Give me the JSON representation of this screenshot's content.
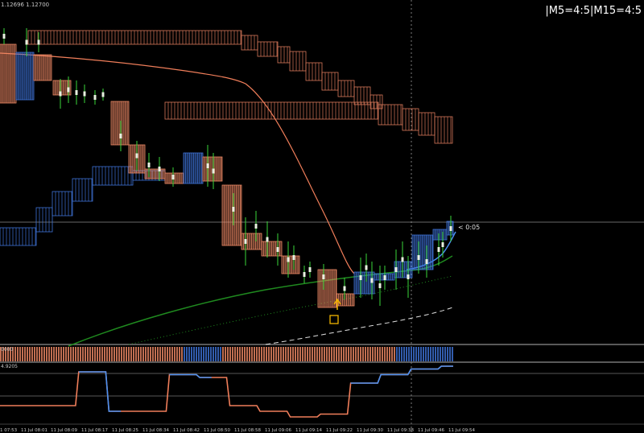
{
  "header": {
    "price_label": "1.12696 1.12700",
    "timeframe_strength": "|M5=4:5|M15=4:5"
  },
  "countdown_label": "< 0:05",
  "subwindow1": {
    "label": "0000"
  },
  "subwindow2": {
    "label": "4.9205"
  },
  "time_axis": {
    "labels": [
      "1 07:53",
      "11 Jul 08:01",
      "11 Jul 08:09",
      "11 Jul 08:17",
      "11 Jul 08:25",
      "11 Jul 08:34",
      "11 Jul 08:42",
      "11 Jul 08:50",
      "11 Jul 08:58",
      "11 Jul 09:06",
      "11 Jul 09:14",
      "11 Jul 09:22",
      "11 Jul 09:30",
      "11 Jul 09:38",
      "11 Jul 09:46",
      "11 Jul 09:54"
    ]
  },
  "colors": {
    "background": "#000000",
    "bear_bar": "#f08a66",
    "bull_bar": "#3f74d9",
    "cloud_bear": "#d9785a",
    "cloud_bull": "#3f74d9",
    "slow_ma": "#f07e5a",
    "green_ma": "#1f8a1f",
    "fast_ma": "#4a8ff0",
    "white_dashed": "#e0e0e0",
    "price_line": "#8a8a8a",
    "signal": "#f0b400"
  },
  "chart_data": {
    "type": "candlestick",
    "symbol": "",
    "timeframe": "M1",
    "y_range": [
      1.124,
      1.129
    ],
    "candles": [
      {
        "t": "07:53",
        "o": 1.1285,
        "h": 1.1287,
        "l": 1.1281,
        "c": 1.12825,
        "color": "bear"
      },
      {
        "t": "07:55",
        "o": 1.12825,
        "h": 1.12845,
        "l": 1.128,
        "c": 1.1284,
        "color": "bull"
      },
      {
        "t": "07:57",
        "o": 1.1284,
        "h": 1.1286,
        "l": 1.1279,
        "c": 1.128,
        "color": "bear"
      },
      {
        "t": "07:59",
        "o": 1.128,
        "h": 1.1283,
        "l": 1.1278,
        "c": 1.1281,
        "color": "bull"
      },
      {
        "t": "08:01",
        "o": 1.1281,
        "h": 1.1284,
        "l": 1.1279,
        "c": 1.128,
        "color": "bear"
      },
      {
        "t": "08:03",
        "o": 1.128,
        "h": 1.1286,
        "l": 1.1279,
        "c": 1.1284,
        "color": "bull"
      },
      {
        "t": "08:05",
        "o": 1.1284,
        "h": 1.1285,
        "l": 1.1278,
        "c": 1.1279,
        "color": "bear"
      },
      {
        "t": "08:09",
        "o": 1.1279,
        "h": 1.1281,
        "l": 1.1277,
        "c": 1.128,
        "color": "bull"
      },
      {
        "t": "08:17",
        "o": 1.12775,
        "h": 1.12785,
        "l": 1.1265,
        "c": 1.1267,
        "color": "bear"
      },
      {
        "t": "08:25",
        "o": 1.1267,
        "h": 1.1269,
        "l": 1.126,
        "c": 1.12615,
        "color": "bear"
      },
      {
        "t": "08:34",
        "o": 1.12615,
        "h": 1.1265,
        "l": 1.1259,
        "c": 1.1263,
        "color": "bull"
      },
      {
        "t": "08:42",
        "o": 1.1263,
        "h": 1.1265,
        "l": 1.1259,
        "c": 1.126,
        "color": "bear"
      },
      {
        "t": "08:50",
        "o": 1.1259,
        "h": 1.126,
        "l": 1.1248,
        "c": 1.125,
        "color": "bear"
      },
      {
        "t": "08:58",
        "o": 1.125,
        "h": 1.1252,
        "l": 1.1245,
        "c": 1.1247,
        "color": "bear"
      },
      {
        "t": "09:06",
        "o": 1.1247,
        "h": 1.1249,
        "l": 1.1243,
        "c": 1.1244,
        "color": "bear"
      },
      {
        "t": "09:14",
        "o": 1.1244,
        "h": 1.1246,
        "l": 1.1241,
        "c": 1.1242,
        "color": "bear"
      },
      {
        "t": "09:22",
        "o": 1.1242,
        "h": 1.1246,
        "l": 1.124,
        "c": 1.1245,
        "color": "bull"
      },
      {
        "t": "09:30",
        "o": 1.1245,
        "h": 1.1249,
        "l": 1.1242,
        "c": 1.1247,
        "color": "bull"
      },
      {
        "t": "09:38",
        "o": 1.1247,
        "h": 1.1252,
        "l": 1.1246,
        "c": 1.1251,
        "color": "bull"
      },
      {
        "t": "09:46",
        "o": 1.1251,
        "h": 1.1255,
        "l": 1.1249,
        "c": 1.1254,
        "color": "bull"
      },
      {
        "t": "09:54",
        "o": 1.1254,
        "h": 1.1257,
        "l": 1.1253,
        "c": 1.1256,
        "color": "bull"
      }
    ],
    "current_price": 1.1256,
    "subwindow2_values": [
      0.3,
      0.3,
      0.3,
      0.9,
      0.2,
      0.2,
      0.85,
      0.8,
      0.3,
      0.2,
      0.1,
      0.15,
      0.7,
      0.85,
      0.95,
      1.0
    ]
  }
}
